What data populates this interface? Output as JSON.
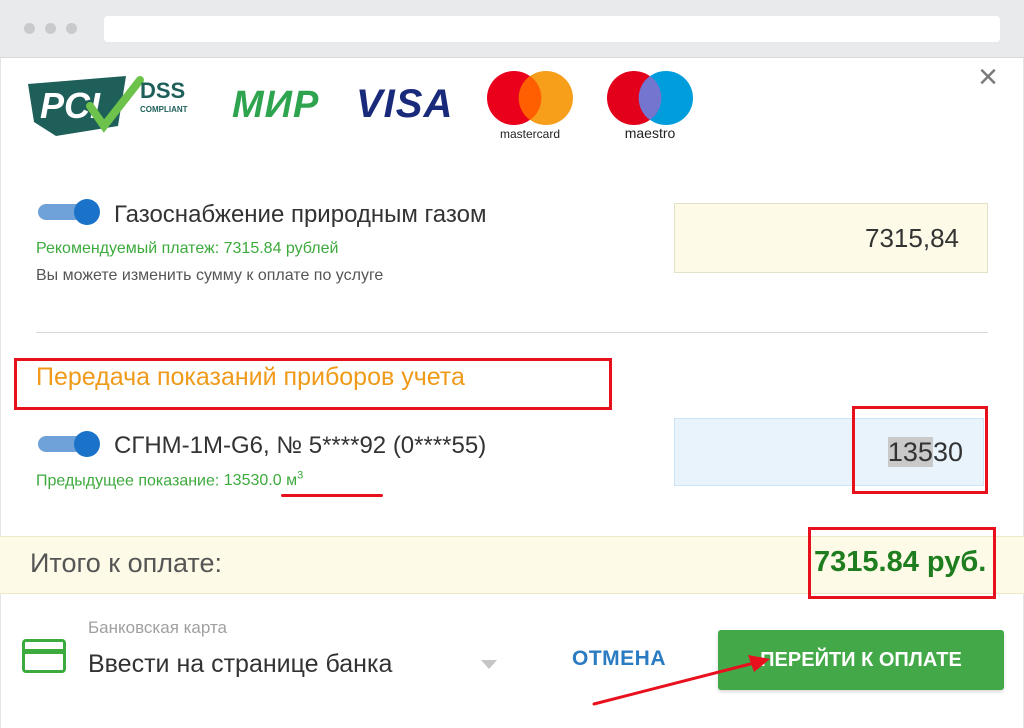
{
  "logos": {
    "pci_main": "PCI",
    "pci_dss": "DSS",
    "pci_compliant": "COMPLIANT",
    "mir": "МИР",
    "visa": "VISA",
    "mastercard": "mastercard",
    "maestro": "maestro"
  },
  "services": [
    {
      "title": "Газоснабжение природным газом",
      "recommended": "Рекомендуемый платеж: 7315.84 рублей",
      "note": "Вы можете изменить сумму к оплате по услуге",
      "amount": "7315,84",
      "enabled": true
    }
  ],
  "meters_section": {
    "heading": "Передача показаний приборов учета",
    "meter": {
      "title": "СГНМ-1М-G6, № 5****92 (0****55)",
      "previous_label": "Предыдущее показание: ",
      "previous_value": "13530.0 м",
      "previous_unit_sup": "3",
      "reading_selected": "135",
      "reading_rest": "30",
      "enabled": true
    }
  },
  "total": {
    "label": "Итого к оплате:",
    "value": "7315.84 руб."
  },
  "payment": {
    "method_label": "Банковская карта",
    "method_value": "Ввести на странице банка",
    "cancel_label": "ОТМЕНА",
    "pay_label": "ПЕРЕЙТИ К ОПЛАТЕ"
  },
  "colors": {
    "accent_green": "#43a847",
    "total_green": "#1e7d1e",
    "heading_orange": "#f09a1a",
    "annotation_red": "#e8101c",
    "link_blue": "#2b7bc2"
  },
  "icons": {
    "close": "close-icon",
    "card": "credit-card-icon",
    "dropdown": "chevron-down-icon"
  }
}
